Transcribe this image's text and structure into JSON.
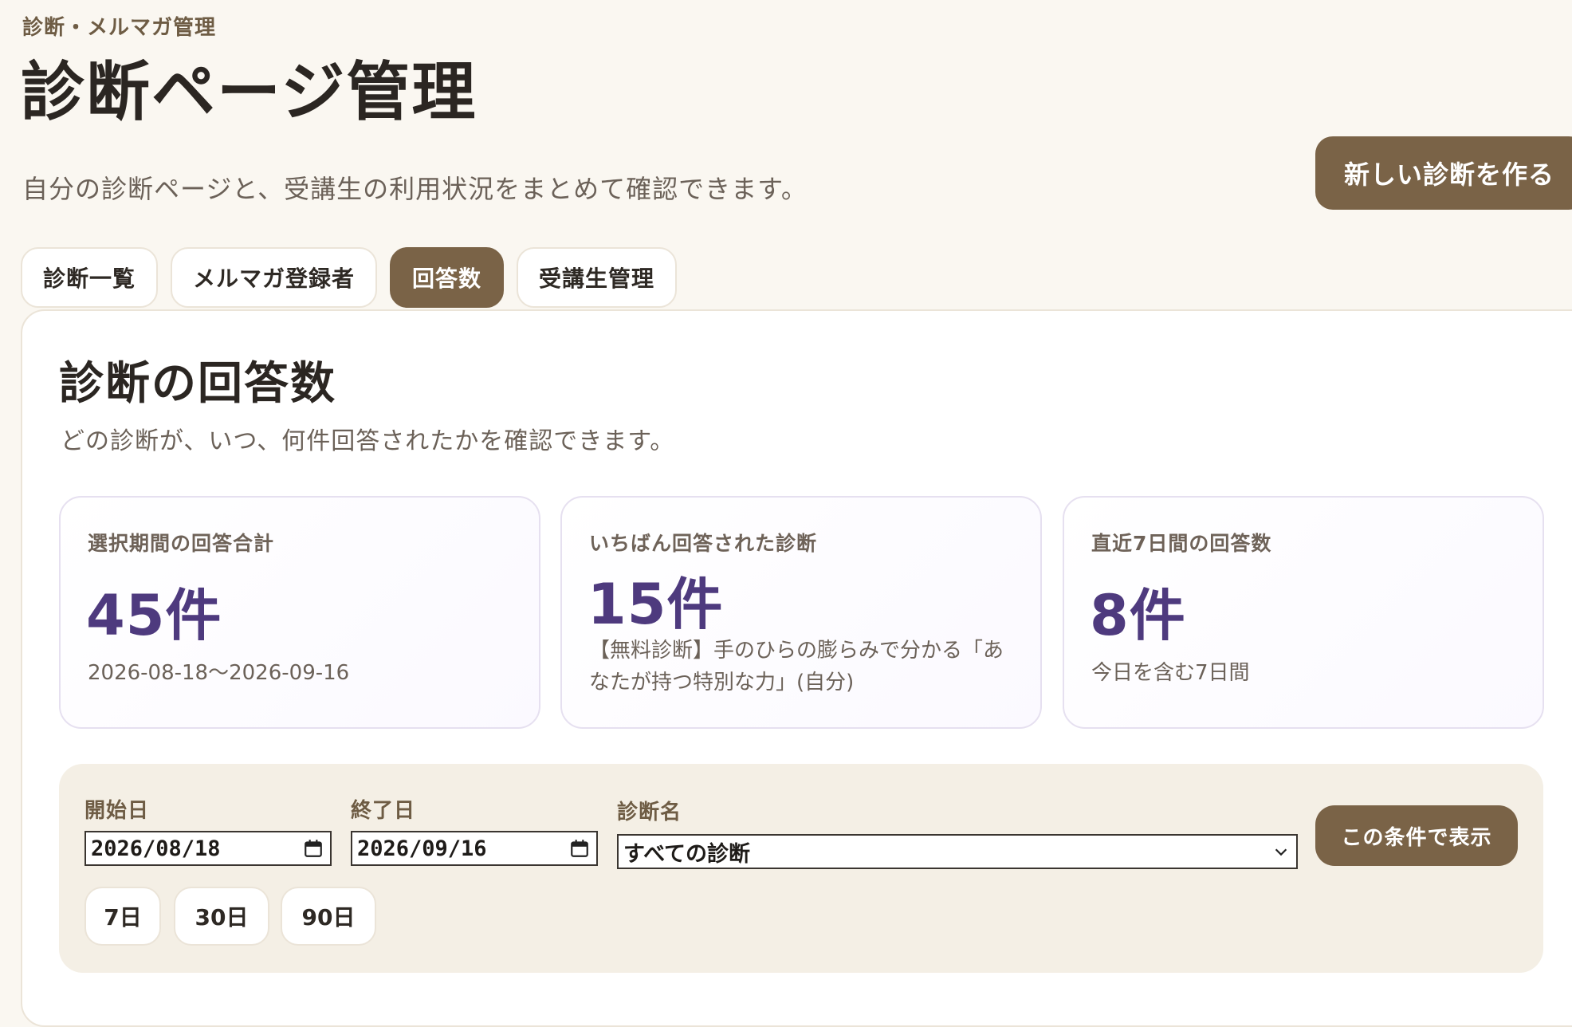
{
  "breadcrumb": "診断・メルマガ管理",
  "header": {
    "title": "診断ページ管理",
    "description": "自分の診断ページと、受講生の利用状況をまとめて確認できます。",
    "create_button": "新しい診断を作る"
  },
  "tabs": [
    {
      "label": "診断一覧",
      "active": false
    },
    {
      "label": "メルマガ登録者",
      "active": false
    },
    {
      "label": "回答数",
      "active": true
    },
    {
      "label": "受講生管理",
      "active": false
    }
  ],
  "panel": {
    "title": "診断の回答数",
    "description": "どの診断が、いつ、何件回答されたかを確認できます。"
  },
  "stats": [
    {
      "label": "選択期間の回答合計",
      "value": "45件",
      "sub": "2026-08-18〜2026-09-16"
    },
    {
      "label": "いちばん回答された診断",
      "value": "15件",
      "sub": "【無料診断】手のひらの膨らみで分かる「あなたが持つ特別な力」(自分)"
    },
    {
      "label": "直近7日間の回答数",
      "value": "8件",
      "sub": "今日を含む7日間"
    }
  ],
  "filters": {
    "start_label": "開始日",
    "start_value": "2026/08/18",
    "end_label": "終了日",
    "end_value": "2026/09/16",
    "diagnosis_label": "診断名",
    "diagnosis_value": "すべての診断",
    "apply_button": "この条件で表示",
    "quick_ranges": [
      "7日",
      "30日",
      "90日"
    ]
  },
  "colors": {
    "accent_brown": "#7a6347",
    "stat_purple": "#4e3a7e",
    "background": "#faf7f1"
  }
}
